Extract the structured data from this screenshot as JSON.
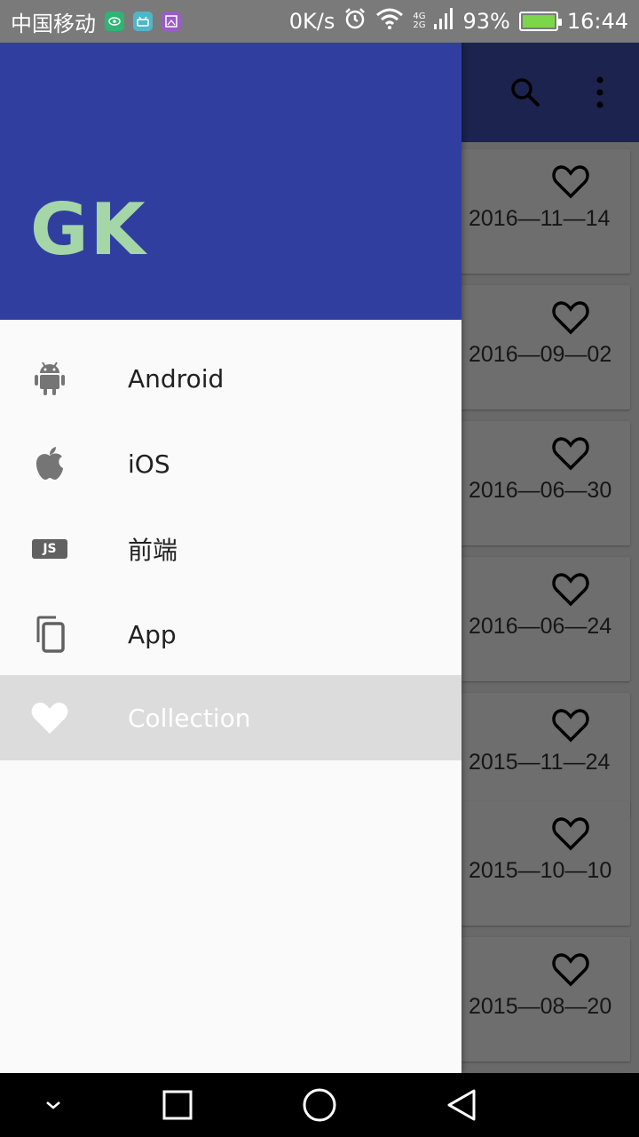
{
  "status_bar": {
    "carrier": "中国移动",
    "speed": "0K/s",
    "net_top": "4G",
    "net_bottom": "2G",
    "battery": "93%",
    "time": "16:44",
    "icons": [
      "eye-app-icon",
      "android-app-icon",
      "gallery-app-icon",
      "alarm-icon",
      "wifi-icon",
      "signal-icon",
      "battery-icon"
    ]
  },
  "toolbar": {
    "icons": [
      "search-icon",
      "overflow-menu-icon"
    ]
  },
  "drawer": {
    "logo": "GK",
    "items": [
      {
        "label": "Android",
        "icon": "android-icon",
        "active": false
      },
      {
        "label": "iOS",
        "icon": "apple-icon",
        "active": false
      },
      {
        "label": "前端",
        "icon": "js-icon",
        "icon_text": "JS",
        "active": false
      },
      {
        "label": "App",
        "icon": "copy-icon",
        "active": false
      },
      {
        "label": "Collection",
        "icon": "heart-icon",
        "active": true
      }
    ]
  },
  "list": {
    "dates": [
      "2016—11—14",
      "2016—09—02",
      "2016—06—30",
      "2016—06—24",
      "2015—11—24",
      "2015—10—10",
      "2015—08—20"
    ]
  },
  "colors": {
    "primary": "#3f51b5",
    "drawer_header": "#303f9f",
    "logo": "#a5d6a7",
    "active_item_bg": "#dcdcdc"
  }
}
